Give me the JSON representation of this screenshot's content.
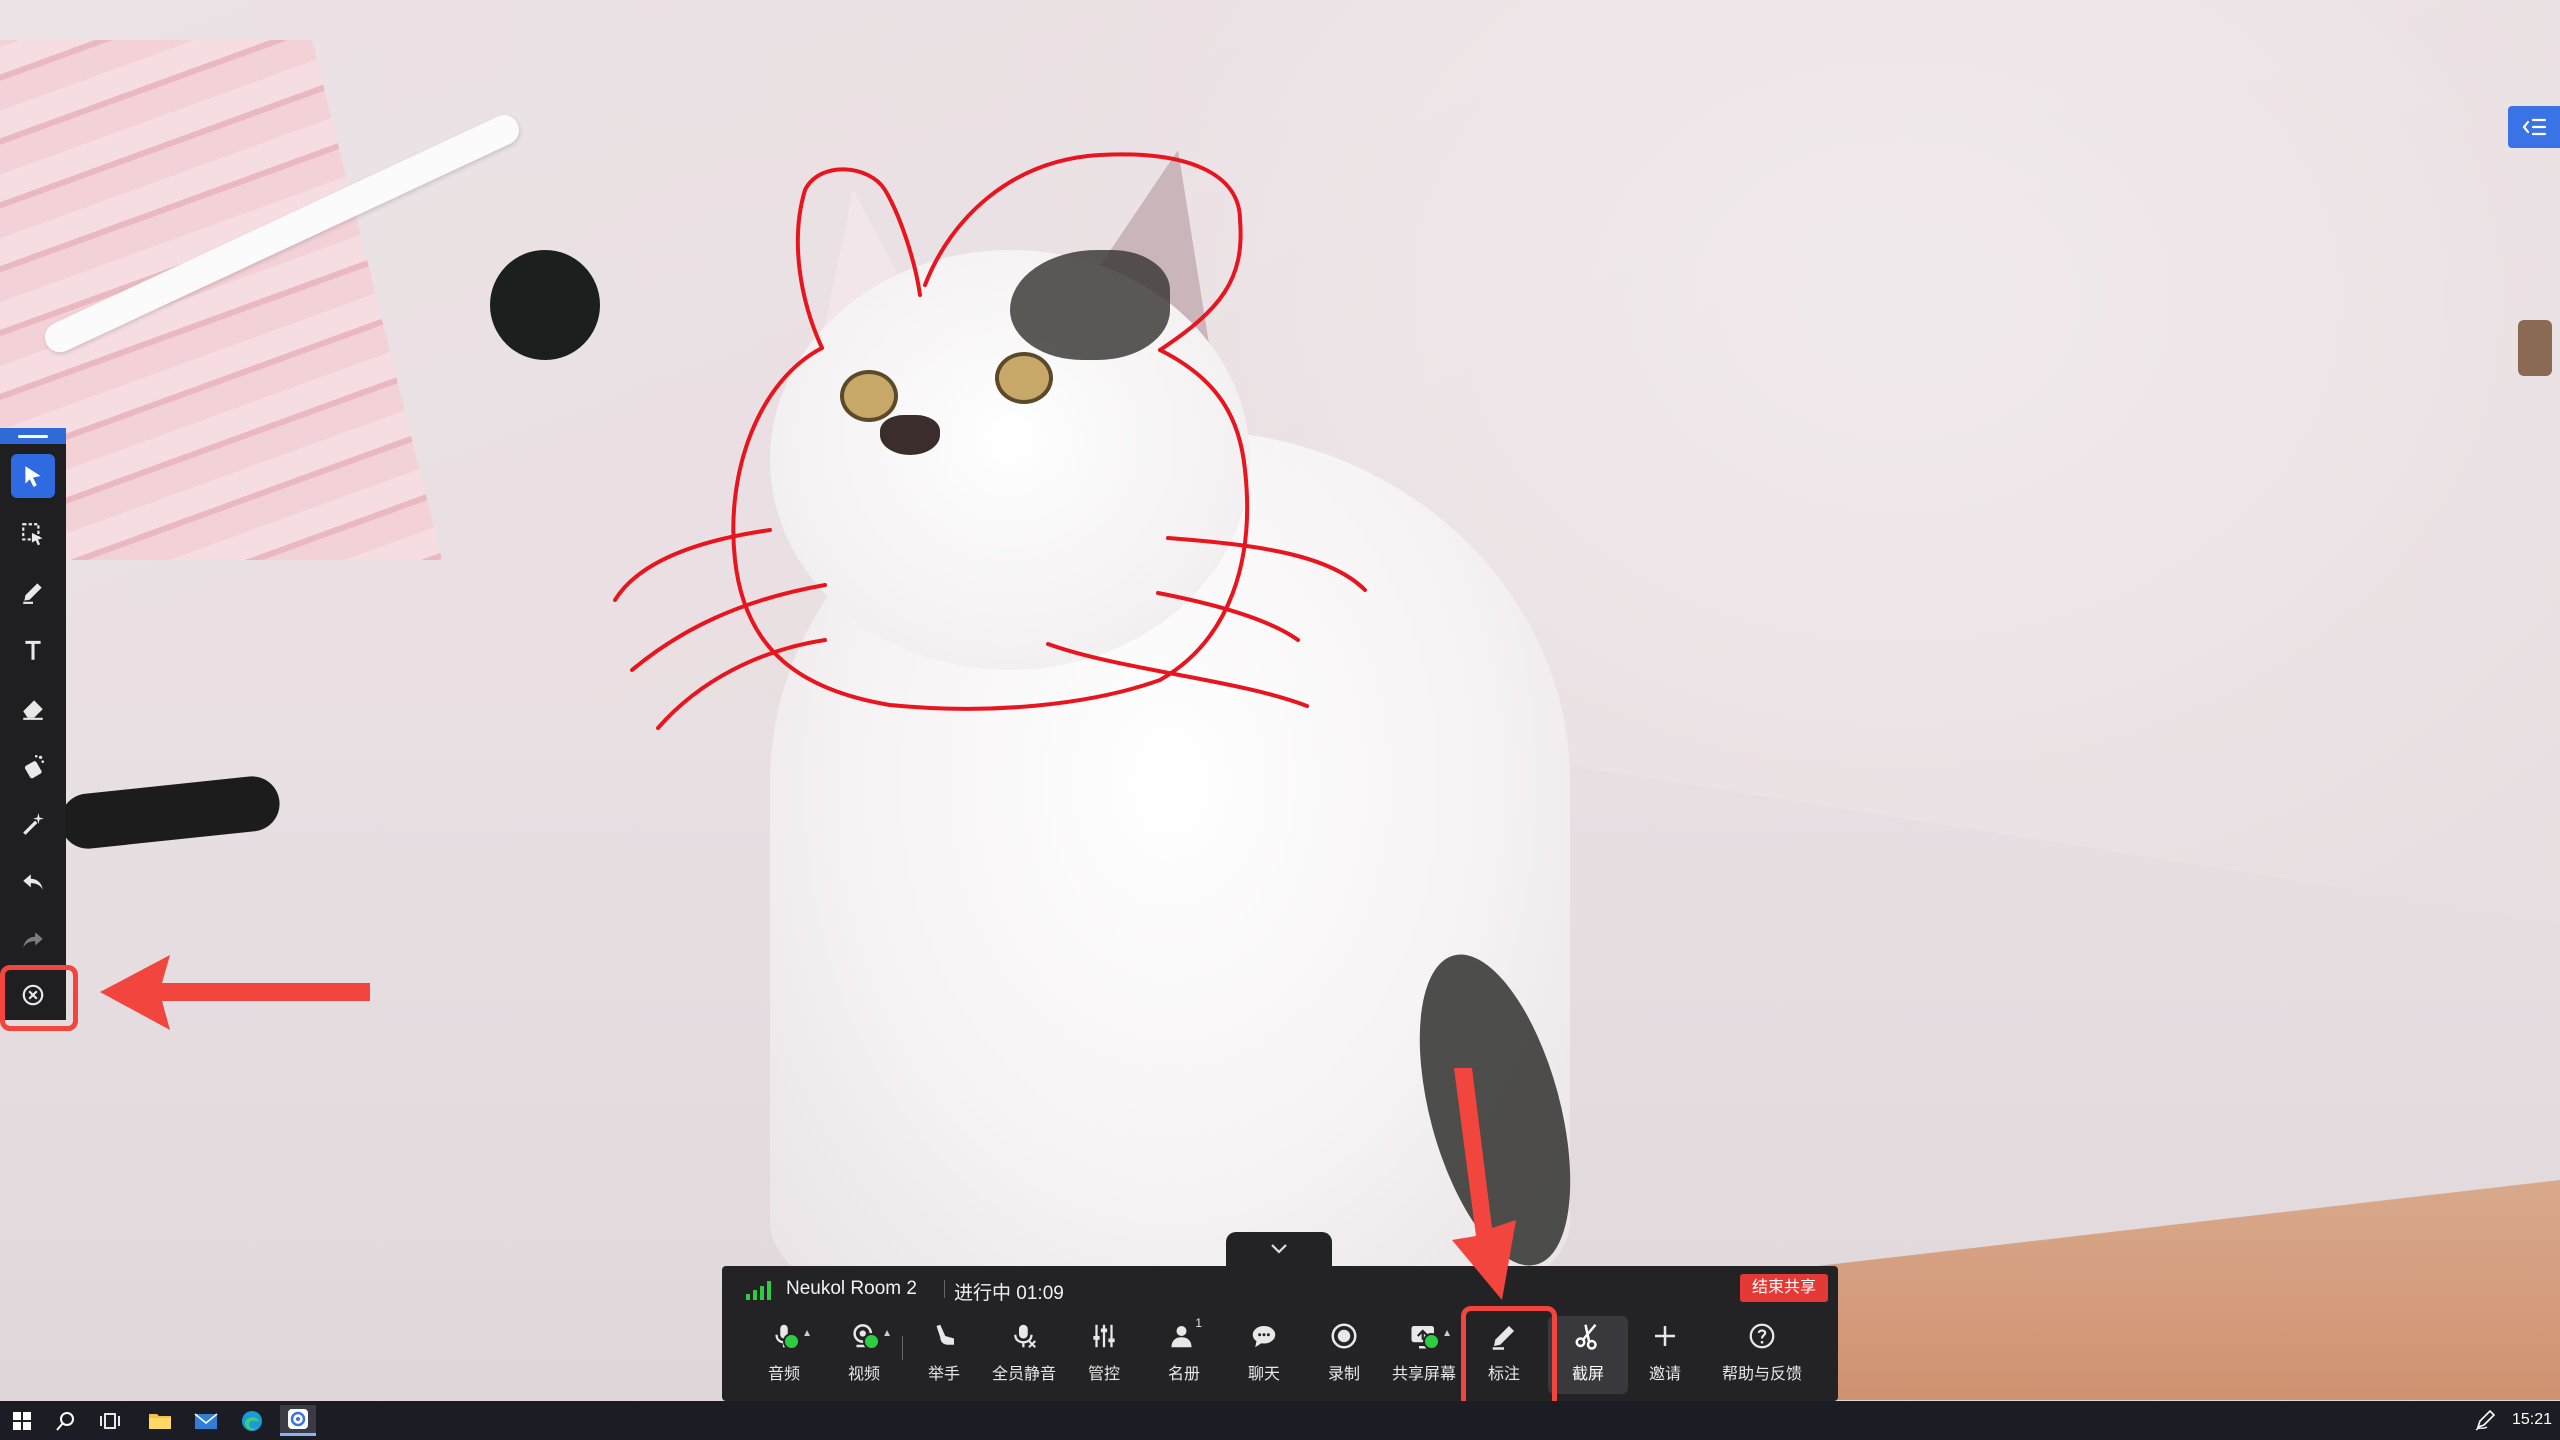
{
  "meeting": {
    "room_name": "Neukol Room 2",
    "status": "进行中 01:09",
    "end_share_label": "结束共享"
  },
  "controls": [
    {
      "id": "audio",
      "label": "音频",
      "icon": "microphone-icon"
    },
    {
      "id": "video",
      "label": "视频",
      "icon": "camera-icon"
    },
    {
      "id": "raise_hand",
      "label": "举手",
      "icon": "raise-hand-icon"
    },
    {
      "id": "mute_all",
      "label": "全员静音",
      "icon": "mute-all-icon"
    },
    {
      "id": "manage",
      "label": "管控",
      "icon": "sliders-icon"
    },
    {
      "id": "roster",
      "label": "名册",
      "icon": "participants-icon"
    },
    {
      "id": "chat",
      "label": "聊天",
      "icon": "chat-icon"
    },
    {
      "id": "record",
      "label": "录制",
      "icon": "record-icon"
    },
    {
      "id": "share_screen",
      "label": "共享屏幕",
      "icon": "share-screen-icon"
    },
    {
      "id": "annotate",
      "label": "标注",
      "icon": "pencil-icon"
    },
    {
      "id": "screenshot",
      "label": "截屏",
      "icon": "scissors-icon"
    },
    {
      "id": "invite",
      "label": "邀请",
      "icon": "plus-icon"
    },
    {
      "id": "help",
      "label": "帮助与反馈",
      "icon": "help-icon"
    }
  ],
  "participants_count": "1",
  "annotation_tools": [
    {
      "id": "select",
      "icon": "cursor-icon",
      "active": true
    },
    {
      "id": "area_select",
      "icon": "area-select-icon"
    },
    {
      "id": "pen",
      "icon": "pen-icon"
    },
    {
      "id": "text",
      "icon": "text-icon"
    },
    {
      "id": "eraser",
      "icon": "eraser-icon"
    },
    {
      "id": "spray",
      "icon": "spray-icon"
    },
    {
      "id": "magic",
      "icon": "magic-wand-icon"
    },
    {
      "id": "undo",
      "icon": "undo-icon"
    },
    {
      "id": "redo",
      "icon": "redo-icon",
      "disabled": true
    },
    {
      "id": "close",
      "icon": "close-circle-icon"
    }
  ],
  "taskbar": {
    "clock": "15:21",
    "apps": [
      "start-icon",
      "search-icon",
      "task-view-icon",
      "file-explorer-icon",
      "mail-icon",
      "edge-icon",
      "meeting-app-icon"
    ]
  },
  "colors": {
    "annotation_ink": "#e8141e",
    "highlight": "#f2453d",
    "accent": "#2f6ae0",
    "end_share": "#e53935",
    "signal": "#2ecc40"
  }
}
